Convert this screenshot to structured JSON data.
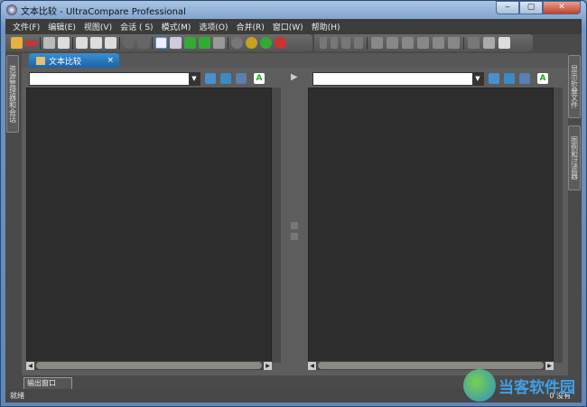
{
  "window": {
    "title": "文本比较 - UltraCompare Professional",
    "minimize": "‒",
    "maximize": "▢",
    "close": "✕"
  },
  "menu": [
    "文件(F)",
    "编辑(E)",
    "视图(V)",
    "会话 ( S)",
    "模式(M)",
    "选项(O)",
    "合并(R)",
    "窗口(W)",
    "帮助(H)"
  ],
  "side_left": {
    "tab": "资源管理器和会话"
  },
  "side_right": {
    "tabs": [
      "显示折叠文件",
      "图例和过滤器"
    ]
  },
  "document": {
    "tab_label": "文本比较",
    "tab_close": "×",
    "left": {
      "path_value": "",
      "dropdown": "▼"
    },
    "right": {
      "path_value": "",
      "dropdown": "▼"
    },
    "gutter_arrow": "▶"
  },
  "output_tab": "输出窗口",
  "status": {
    "text": "就绪",
    "right_count": "0",
    "right_text": "没有"
  },
  "watermark": {
    "text": "当客软件园"
  }
}
